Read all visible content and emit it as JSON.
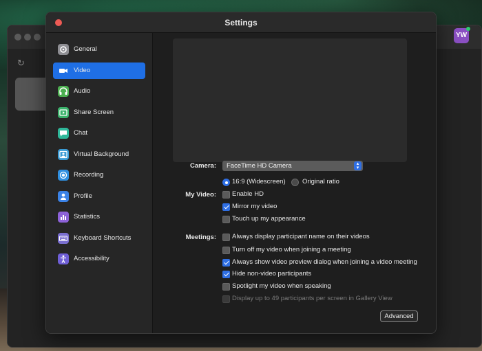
{
  "window": {
    "title": "Settings"
  },
  "background_app": {
    "avatar_initials": "YW"
  },
  "sidebar": {
    "items": [
      {
        "label": "General",
        "icon": "gear-icon",
        "color": "#8e8e93",
        "active": false
      },
      {
        "label": "Video",
        "icon": "video-icon",
        "color": "#1f6fe5",
        "active": true
      },
      {
        "label": "Audio",
        "icon": "headphones-icon",
        "color": "#4caf50",
        "active": false
      },
      {
        "label": "Share Screen",
        "icon": "share-screen-icon",
        "color": "#3bb26b",
        "active": false
      },
      {
        "label": "Chat",
        "icon": "chat-icon",
        "color": "#2fb89a",
        "active": false
      },
      {
        "label": "Virtual Background",
        "icon": "virtual-background-icon",
        "color": "#3a9bd5",
        "active": false
      },
      {
        "label": "Recording",
        "icon": "recording-icon",
        "color": "#2f8fe0",
        "active": false
      },
      {
        "label": "Profile",
        "icon": "profile-icon",
        "color": "#3b82e6",
        "active": false
      },
      {
        "label": "Statistics",
        "icon": "statistics-icon",
        "color": "#8d62d9",
        "active": false
      },
      {
        "label": "Keyboard Shortcuts",
        "icon": "keyboard-icon",
        "color": "#7a6fd0",
        "active": false
      },
      {
        "label": "Accessibility",
        "icon": "accessibility-icon",
        "color": "#6f5fd6",
        "active": false
      }
    ]
  },
  "video": {
    "camera_label": "Camera:",
    "camera_value": "FaceTime HD Camera",
    "my_video_label": "My Video:",
    "aspect": [
      {
        "label": "16:9 (Widescreen)",
        "selected": true
      },
      {
        "label": "Original ratio",
        "selected": false
      }
    ],
    "my_video_options": [
      {
        "label": "Enable HD",
        "checked": false
      },
      {
        "label": "Mirror my video",
        "checked": true
      },
      {
        "label": "Touch up my appearance",
        "checked": false
      }
    ],
    "meetings_label": "Meetings:",
    "meeting_options": [
      {
        "label": "Always display participant name on their videos",
        "checked": false,
        "disabled": false
      },
      {
        "label": "Turn off my video when joining a meeting",
        "checked": false,
        "disabled": false
      },
      {
        "label": "Always show video preview dialog when joining a video meeting",
        "checked": true,
        "disabled": false
      },
      {
        "label": "Hide non-video participants",
        "checked": true,
        "disabled": false
      },
      {
        "label": "Spotlight my video when speaking",
        "checked": false,
        "disabled": false
      },
      {
        "label": "Display up to 49 participants per screen in Gallery View",
        "checked": false,
        "disabled": true
      }
    ],
    "advanced_label": "Advanced"
  }
}
